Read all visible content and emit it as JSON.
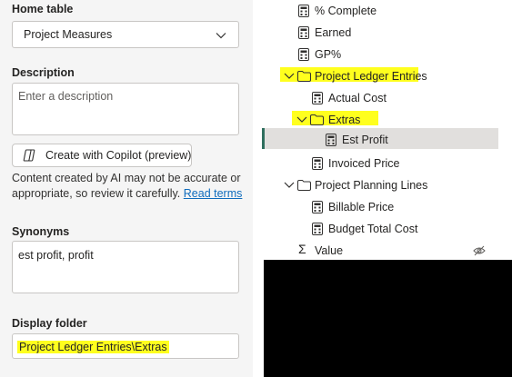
{
  "properties": {
    "home_table": {
      "label": "Home table",
      "value": "Project Measures"
    },
    "description": {
      "label": "Description",
      "placeholder": "Enter a description"
    },
    "copilot_button": "Create with Copilot (preview)",
    "ai_note": "Content created by AI may not be accurate or appropriate, so review it carefully.",
    "read_terms": "Read terms",
    "synonyms": {
      "label": "Synonyms",
      "value": "est profit, profit"
    },
    "display_folder": {
      "label": "Display folder",
      "value": "Project Ledger Entries\\Extras"
    }
  },
  "tree": {
    "items": [
      {
        "label": "% Complete",
        "icon": "calculator-icon"
      },
      {
        "label": "Earned",
        "icon": "calculator-icon"
      },
      {
        "label": "GP%",
        "icon": "calculator-icon"
      },
      {
        "label": "Project Ledger Entries",
        "icon": "folder-icon",
        "expanded": true
      },
      {
        "label": "Actual Cost",
        "icon": "calculator-icon"
      },
      {
        "label": "Extras",
        "icon": "folder-icon",
        "expanded": true
      },
      {
        "label": "Est Profit",
        "icon": "calculator-icon",
        "selected": true
      },
      {
        "label": "Invoiced Price",
        "icon": "calculator-icon"
      },
      {
        "label": "Project Planning Lines",
        "icon": "folder-icon",
        "expanded": true
      },
      {
        "label": "Billable Price",
        "icon": "calculator-icon"
      },
      {
        "label": "Budget Total Cost",
        "icon": "calculator-icon"
      },
      {
        "label": "Value",
        "icon": "sigma-icon",
        "hidden": true
      }
    ]
  },
  "colors": {
    "highlight": "#ffff1e",
    "selected_bg": "#e1dfdd",
    "selected_bar": "#2f6f5e",
    "link": "#0f6cbd"
  }
}
